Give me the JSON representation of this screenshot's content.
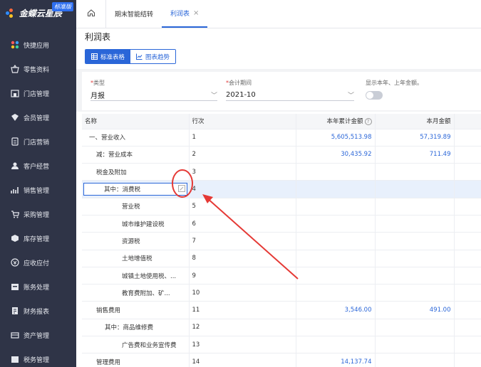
{
  "brand": {
    "name": "金蝶云星辰",
    "edition": "标准版"
  },
  "sidebar": {
    "items": [
      {
        "label": "快捷应用",
        "icon": "apps-icon"
      },
      {
        "label": "零售资料",
        "icon": "basket-icon"
      },
      {
        "label": "门店管理",
        "icon": "store-icon"
      },
      {
        "label": "会员管理",
        "icon": "member-icon"
      },
      {
        "label": "门店营销",
        "icon": "marketing-icon"
      },
      {
        "label": "客户经营",
        "icon": "customer-icon"
      },
      {
        "label": "销售管理",
        "icon": "sales-icon"
      },
      {
        "label": "采购管理",
        "icon": "cart-icon"
      },
      {
        "label": "库存管理",
        "icon": "box-icon"
      },
      {
        "label": "应收应付",
        "icon": "money-icon"
      },
      {
        "label": "账务处理",
        "icon": "ledger-icon"
      },
      {
        "label": "财务报表",
        "icon": "report-icon"
      },
      {
        "label": "资产管理",
        "icon": "asset-icon"
      },
      {
        "label": "税务管理",
        "icon": "tax-icon"
      }
    ]
  },
  "tabs": [
    {
      "label": "期末智能结转"
    },
    {
      "label": "利润表",
      "close": "×"
    }
  ],
  "page": {
    "title": "利润表",
    "view_table": "标准表格",
    "view_chart": "图表趋势"
  },
  "filters": {
    "required_mark": "*",
    "type_label": "类型",
    "type_value": "月报",
    "period_label": "会计期间",
    "period_value": "2021-10",
    "show_label": "显示本年、上年金额。"
  },
  "table": {
    "headers": {
      "name": "名称",
      "line": "行次",
      "ytd": "本年累计金额",
      "month": "本月金额"
    },
    "rows": [
      {
        "name": "一、营业收入",
        "line": "1",
        "ytd": "5,605,513.98",
        "month": "57,319.89"
      },
      {
        "name": "减：营业成本",
        "line": "2",
        "ytd": "30,435.92",
        "month": "711.49"
      },
      {
        "name": "税金及附加",
        "line": "3",
        "ytd": "",
        "month": ""
      },
      {
        "name": "其中：消费税",
        "line": "4",
        "ytd": "",
        "month": ""
      },
      {
        "name": "营业税",
        "line": "5",
        "ytd": "",
        "month": ""
      },
      {
        "name": "城市维护建设税",
        "line": "6",
        "ytd": "",
        "month": ""
      },
      {
        "name": "资源税",
        "line": "7",
        "ytd": "",
        "month": ""
      },
      {
        "name": "土地增值税",
        "line": "8",
        "ytd": "",
        "month": ""
      },
      {
        "name": "城镇土地使用税、...",
        "line": "9",
        "ytd": "",
        "month": ""
      },
      {
        "name": "教育费附加、矿...",
        "line": "10",
        "ytd": "",
        "month": ""
      },
      {
        "name": "销售费用",
        "line": "11",
        "ytd": "3,546.00",
        "month": "491.00"
      },
      {
        "name": "其中：商品维修费",
        "line": "12",
        "ytd": "",
        "month": ""
      },
      {
        "name": "广告费和业务宣传费",
        "line": "13",
        "ytd": "",
        "month": ""
      },
      {
        "name": "管理费用",
        "line": "14",
        "ytd": "14,137.74",
        "month": ""
      }
    ]
  },
  "colors": {
    "accent": "#2a66d8",
    "sidebar": "#2f3447",
    "annotation": "#e53935"
  }
}
